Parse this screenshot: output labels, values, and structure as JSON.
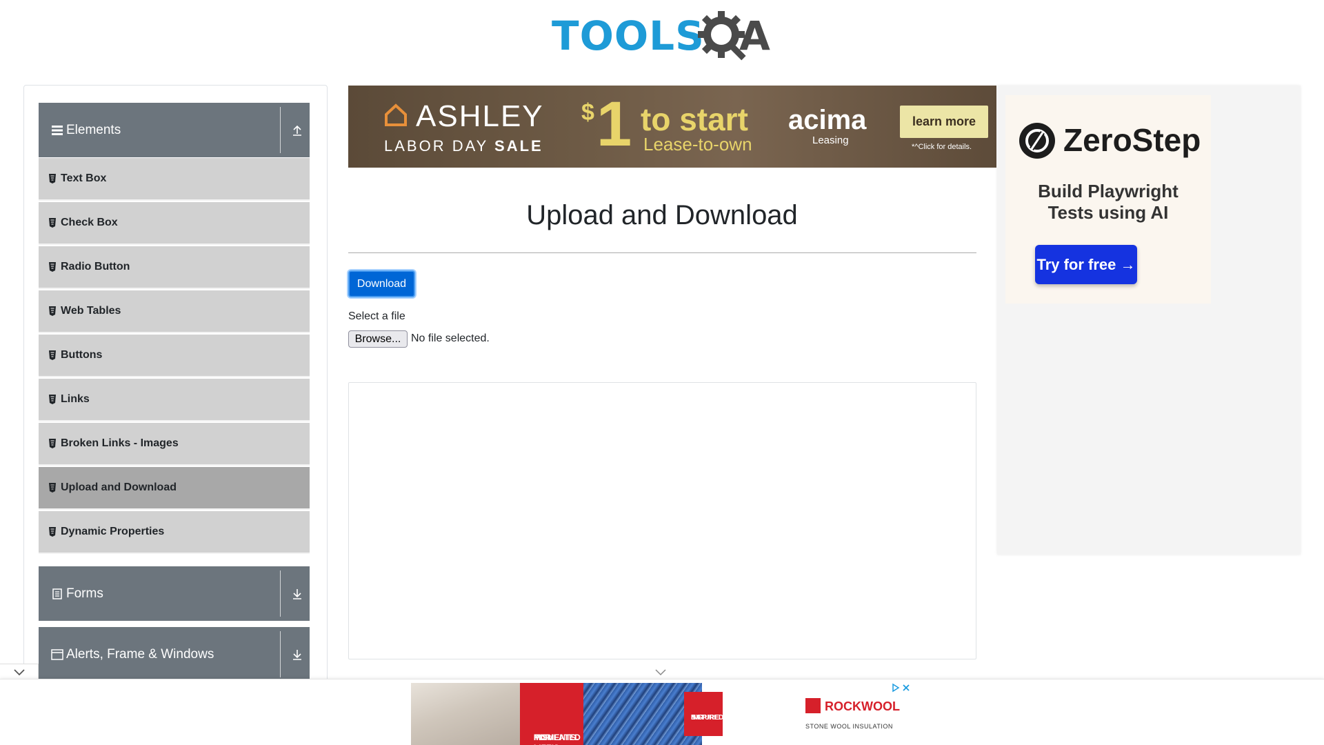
{
  "logo": {
    "word": "TOOLS",
    "a_letter": "A"
  },
  "sidebar": {
    "groups": [
      {
        "label": "Elements",
        "icon": "hamburger-icon",
        "expanded": true
      },
      {
        "label": "Forms",
        "icon": "document-icon",
        "expanded": false
      },
      {
        "label": "Alerts, Frame & Windows",
        "icon": "window-icon",
        "expanded": false
      }
    ],
    "items": [
      {
        "label": "Text Box"
      },
      {
        "label": "Check Box"
      },
      {
        "label": "Radio Button"
      },
      {
        "label": "Web Tables"
      },
      {
        "label": "Buttons"
      },
      {
        "label": "Links"
      },
      {
        "label": "Broken Links - Images"
      },
      {
        "label": "Upload and Download",
        "active": true
      },
      {
        "label": "Dynamic Properties"
      }
    ]
  },
  "top_ad": {
    "brand": "ASHLEY",
    "sale_pre": "LABOR DAY ",
    "sale_bold": "SALE",
    "dollar": "$",
    "price": "1",
    "to_start": "to start",
    "lease": "Lease-to-own",
    "partner": "acima",
    "partner_sub": "Leasing",
    "cta": "learn more",
    "details": "*^Click for details."
  },
  "main": {
    "title": "Upload and Download",
    "download_label": "Download",
    "select_label": "Select a file",
    "browse_label": "Browse...",
    "file_status": "No file selected."
  },
  "right_ad": {
    "brand": "ZeroStep",
    "tagline_1": "Build Playwright",
    "tagline_2": "Tests using AI",
    "cta": "Try for free →"
  },
  "bottom_ad": {
    "red_text_1": "INSULATED",
    "red_text_2": "FOR LIFE'S",
    "red_text_3": "MOMENTS.",
    "badge_1": "INSPIRED",
    "badge_2": "BY",
    "badge_3": "NATURE.",
    "brand": "ROCKWOOL",
    "brand_sub": "STONE WOOL INSULATION"
  },
  "colors": {
    "primary": "#0066d6",
    "sidebar_header": "#6c757d",
    "menu_item": "#d1d1d1",
    "menu_item_active": "#a8a8a8",
    "logo_blue": "#1e9bd7"
  }
}
